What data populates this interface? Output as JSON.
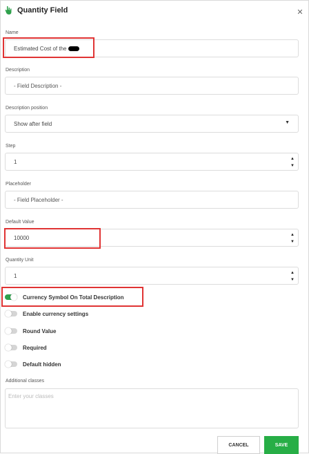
{
  "header": {
    "title": "Quantity Field",
    "icon": "hand-icon",
    "close_icon": "close-icon"
  },
  "name": {
    "label": "Name",
    "value": "Estimated Cost of the"
  },
  "description": {
    "label": "Description",
    "value": "- Field Description -"
  },
  "description_position": {
    "label": "Description position",
    "value": "Show after field"
  },
  "step": {
    "label": "Step",
    "value": "1"
  },
  "placeholder": {
    "label": "Placeholder",
    "value": "- Field Placeholder -"
  },
  "default_value": {
    "label": "Default Value",
    "value": "10000"
  },
  "quantity_unit": {
    "label": "Quantity Unit",
    "value": "1"
  },
  "toggles": [
    {
      "label": "Currency Symbol On Total Description",
      "on": true
    },
    {
      "label": "Enable currency settings",
      "on": false
    },
    {
      "label": "Round Value",
      "on": false
    },
    {
      "label": "Required",
      "on": false
    },
    {
      "label": "Default hidden",
      "on": false
    }
  ],
  "additional_classes": {
    "label": "Additional classes",
    "placeholder": "Enter your classes"
  },
  "buttons": {
    "cancel": "CANCEL",
    "save": "SAVE"
  },
  "colors": {
    "accent": "#27ae46",
    "highlight": "#e03333"
  }
}
